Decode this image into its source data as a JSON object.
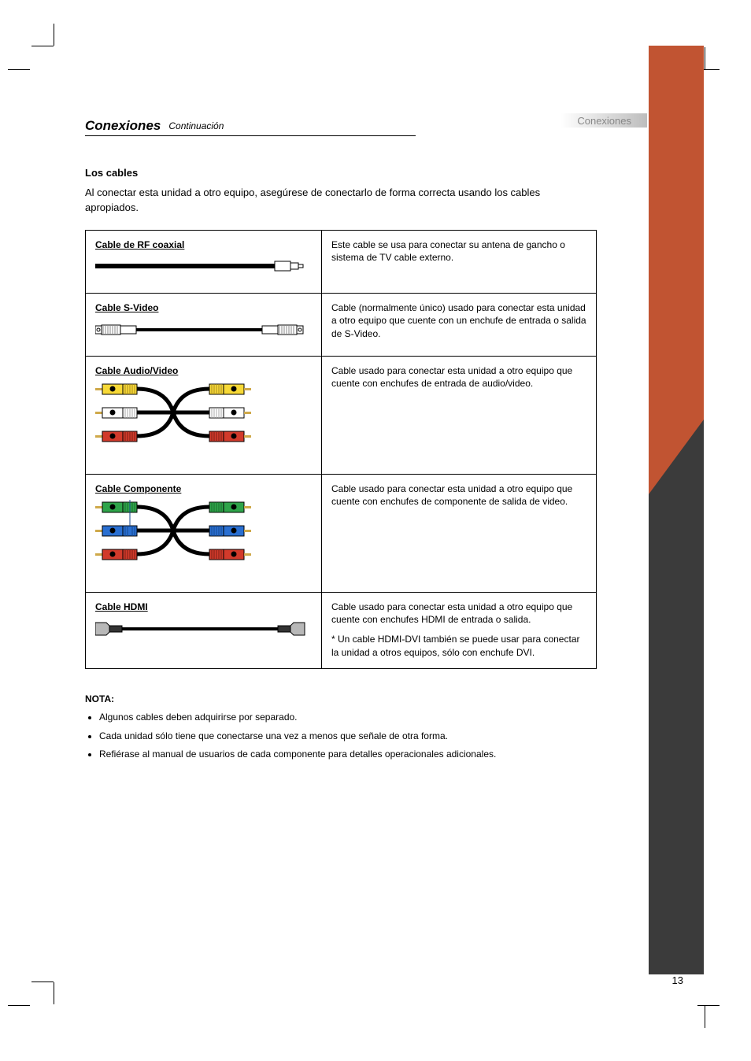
{
  "header": {
    "title": "Conexiones",
    "subtitle": "Continuación",
    "category_label": "Conexiones"
  },
  "intro": {
    "line1": "Los cables",
    "line2": "Al conectar esta unidad a otro equipo, asegúrese de conectarlo de forma correcta usando los cables",
    "line3": "apropiados."
  },
  "table": [
    {
      "title": "Cable de RF coaxial",
      "desc": "Este cable se usa para conectar su antena de gancho o sistema de TV cable externo."
    },
    {
      "title": "Cable S-Video",
      "desc": "Cable (normalmente único) usado para conectar esta unidad a otro equipo que cuente con un enchufe de entrada o salida de S-Video."
    },
    {
      "title": "Cable Audio/Video",
      "desc": "Cable usado para conectar esta unidad a otro equipo que cuente con enchufes de entrada de audio/video."
    },
    {
      "title": "Cable Componente",
      "desc": "Cable usado para conectar esta unidad a otro equipo que cuente con enchufes de componente de salida de video."
    },
    {
      "title": "Cable HDMI",
      "desc1": "Cable usado para conectar esta unidad a otro equipo que cuente con enchufes HDMI de entrada o salida.",
      "desc2": "* Un cable HDMI-DVI también se puede usar para conectar la unidad a otros equipos, sólo con enchufe DVI."
    }
  ],
  "notice": {
    "heading": "NOTA:",
    "items": [
      "Algunos cables deben adquirirse por separado.",
      "Cada unidad sólo tiene que conectarse una vez a menos que señale de otra forma.",
      "Refiérase al manual de usuarios de cada componente para detalles operacionales adicionales."
    ]
  },
  "page_number": "13"
}
